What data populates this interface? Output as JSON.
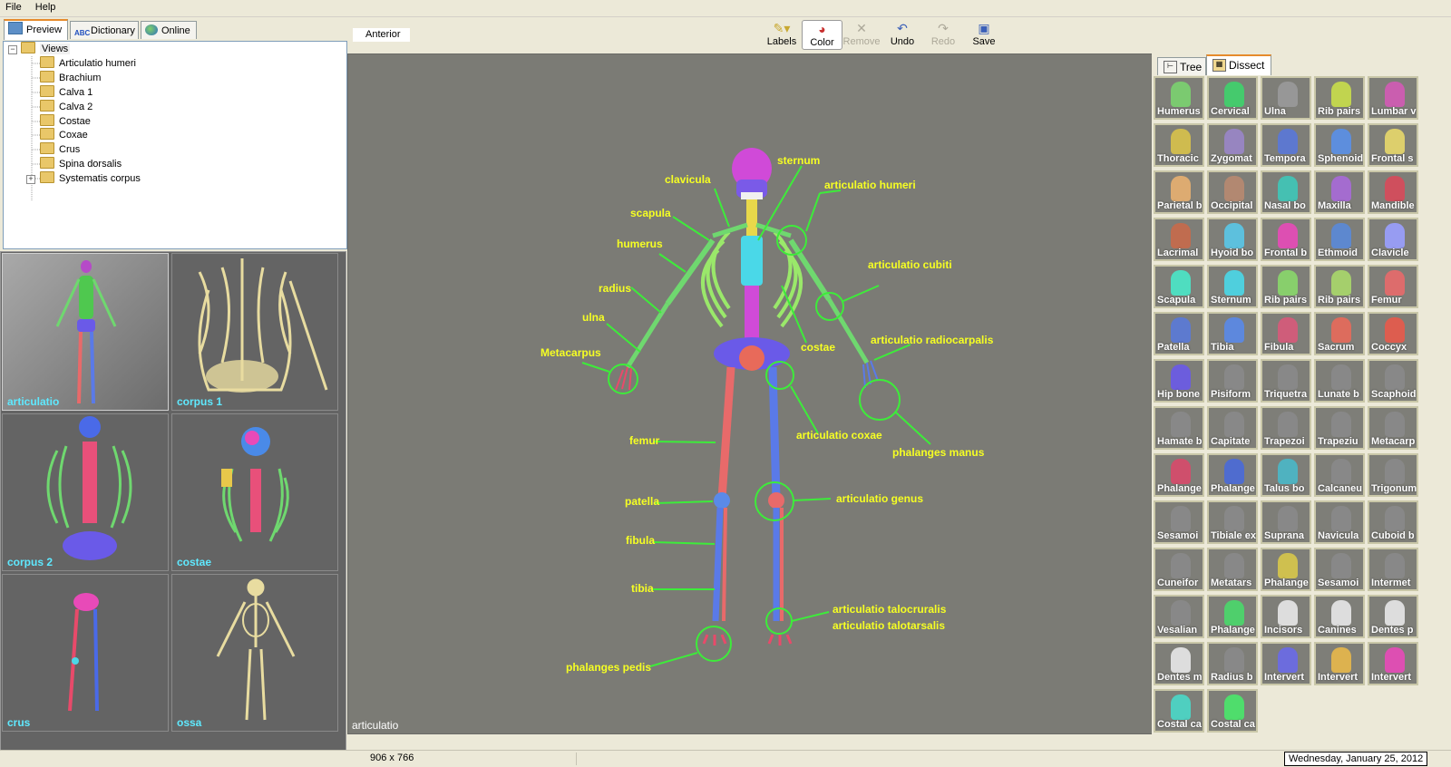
{
  "menu": [
    "File",
    "Help"
  ],
  "left_tabs": [
    {
      "label": "Preview",
      "icon": "preview-icon"
    },
    {
      "label": "Dictionary",
      "icon": "abc-icon",
      "badge": "ABC"
    },
    {
      "label": "Online",
      "icon": "globe-icon"
    }
  ],
  "tree": {
    "root": "Views",
    "items": [
      "Articulatio humeri",
      "Brachium",
      "Calva 1",
      "Calva 2",
      "Costae",
      "Coxae",
      "Crus",
      "Spina dorsalis",
      "Systematis corpus"
    ]
  },
  "thumbnails": [
    "articulatio",
    "corpus 1",
    "corpus 2",
    "costae",
    "crus",
    "ossa"
  ],
  "view_name": "Anterior",
  "toolbar": {
    "labels": "Labels",
    "color": "Color",
    "remove": "Remove",
    "undo": "Undo",
    "redo": "Redo",
    "save": "Save"
  },
  "viewport": {
    "caption": "articulatio",
    "labels": {
      "sternum": "sternum",
      "clavicula": "clavicula",
      "articulatio_humeri": "articulatio humeri",
      "scapula": "scapula",
      "humerus": "humerus",
      "articulatio_cubiti": "articulatio cubiti",
      "radius": "radius",
      "ulna": "ulna",
      "costae": "costae",
      "articulatio_radiocarpalis": "articulatio radiocarpalis",
      "metacarpus": "Metacarpus",
      "articulatio_coxae": "articulatio coxae",
      "phalanges_manus": "phalanges manus",
      "femur": "femur",
      "patella": "patella",
      "articulatio_genus": "articulatio genus",
      "fibula": "fibula",
      "tibia": "tibia",
      "articulatio_talocruralis": "articulatio talocruralis",
      "articulatio_talotarsalis": "articulatio talotarsalis",
      "phalanges_pedis": "phalanges pedis"
    }
  },
  "right_tabs": [
    "Tree",
    "Dissect"
  ],
  "dissect_items": [
    {
      "label": "Humerus",
      "color": "#7bd36f"
    },
    {
      "label": "Cervical",
      "color": "#3fd36b"
    },
    {
      "label": "Ulna",
      "color": "#9a9a9a"
    },
    {
      "label": "Rib pairs",
      "color": "#c9de4a"
    },
    {
      "label": "Lumbar v",
      "color": "#d35bb5"
    },
    {
      "label": "Thoracic",
      "color": "#d8c24a"
    },
    {
      "label": "Zygomat",
      "color": "#9a86c8"
    },
    {
      "label": "Tempora",
      "color": "#5a78d8"
    },
    {
      "label": "Sphenoid",
      "color": "#5a90e8"
    },
    {
      "label": "Frontal s",
      "color": "#e8d86a"
    },
    {
      "label": "Parietal b",
      "color": "#e8b070"
    },
    {
      "label": "Occipital",
      "color": "#b88a70"
    },
    {
      "label": "Nasal bo",
      "color": "#3fc8b8"
    },
    {
      "label": "Maxilla",
      "color": "#a86ad8"
    },
    {
      "label": "Mandible",
      "color": "#d84a5a"
    },
    {
      "label": "Lacrimal",
      "color": "#c86a4a"
    },
    {
      "label": "Hyoid bo",
      "color": "#5ac8e8"
    },
    {
      "label": "Frontal b",
      "color": "#e84ab8"
    },
    {
      "label": "Ethmoid",
      "color": "#5a8ad8"
    },
    {
      "label": "Clavicle",
      "color": "#9aa0ff"
    },
    {
      "label": "Scapula",
      "color": "#4ae8c8"
    },
    {
      "label": "Sternum",
      "color": "#4ad8e8"
    },
    {
      "label": "Rib pairs",
      "color": "#8ad86a"
    },
    {
      "label": "Rib pairs",
      "color": "#aad86a"
    },
    {
      "label": "Femur",
      "color": "#e86a6a"
    },
    {
      "label": "Patella",
      "color": "#5a7ad8"
    },
    {
      "label": "Tibia",
      "color": "#5a8ae8"
    },
    {
      "label": "Fibula",
      "color": "#d85a7a"
    },
    {
      "label": "Sacrum",
      "color": "#e86a5a"
    },
    {
      "label": "Coccyx",
      "color": "#e85a4a"
    },
    {
      "label": "Hip bone",
      "color": "#6a5ae8"
    },
    {
      "label": "Pisiform",
      "color": "#8a8a8a"
    },
    {
      "label": "Triquetra",
      "color": "#8a8a8a"
    },
    {
      "label": "Lunate b",
      "color": "#8a8a8a"
    },
    {
      "label": "Scaphoid",
      "color": "#8a8a8a"
    },
    {
      "label": "Hamate b",
      "color": "#8a8a8a"
    },
    {
      "label": "Capitate",
      "color": "#8a8a8a"
    },
    {
      "label": "Trapezoi",
      "color": "#8a8a8a"
    },
    {
      "label": "Trapeziu",
      "color": "#8a8a8a"
    },
    {
      "label": "Metacarp",
      "color": "#8a8a8a"
    },
    {
      "label": "Phalange",
      "color": "#d84a6a"
    },
    {
      "label": "Phalange",
      "color": "#4a6ad8"
    },
    {
      "label": "Talus bo",
      "color": "#4ab8c8"
    },
    {
      "label": "Calcaneu",
      "color": "#8a8a8a"
    },
    {
      "label": "Trigonum",
      "color": "#8a8a8a"
    },
    {
      "label": "Sesamoi",
      "color": "#8a8a8a"
    },
    {
      "label": "Tibiale ex",
      "color": "#8a8a8a"
    },
    {
      "label": "Suprana",
      "color": "#8a8a8a"
    },
    {
      "label": "Navicula",
      "color": "#8a8a8a"
    },
    {
      "label": "Cuboid b",
      "color": "#8a8a8a"
    },
    {
      "label": "Cuneifor",
      "color": "#8a8a8a"
    },
    {
      "label": "Metatars",
      "color": "#8a8a8a"
    },
    {
      "label": "Phalange",
      "color": "#d8c84a"
    },
    {
      "label": "Sesamoi",
      "color": "#8a8a8a"
    },
    {
      "label": "Intermet",
      "color": "#8a8a8a"
    },
    {
      "label": "Vesalian",
      "color": "#8a8a8a"
    },
    {
      "label": "Phalange",
      "color": "#4ad86a"
    },
    {
      "label": "Incisors",
      "color": "#e8e8e8"
    },
    {
      "label": "Canines",
      "color": "#e8e8e8"
    },
    {
      "label": "Dentes p",
      "color": "#e8e8e8"
    },
    {
      "label": "Dentes m",
      "color": "#e8e8e8"
    },
    {
      "label": "Radius b",
      "color": "#8a8a8a"
    },
    {
      "label": "Intervert",
      "color": "#6a6ae8"
    },
    {
      "label": "Intervert",
      "color": "#e8b84a"
    },
    {
      "label": "Intervert",
      "color": "#e84ab8"
    },
    {
      "label": "Costal ca",
      "color": "#4ad8c8"
    },
    {
      "label": "Costal ca",
      "color": "#4ae86a"
    }
  ],
  "status": {
    "size": "906 x 766",
    "date": "Wednesday, January 25, 2012"
  },
  "colors": {
    "label_yellow": "#f6ff23",
    "leader_green": "#3dec3a",
    "viewport_bg": "#7b7b75",
    "thumb_caption": "#5fe9ff"
  }
}
